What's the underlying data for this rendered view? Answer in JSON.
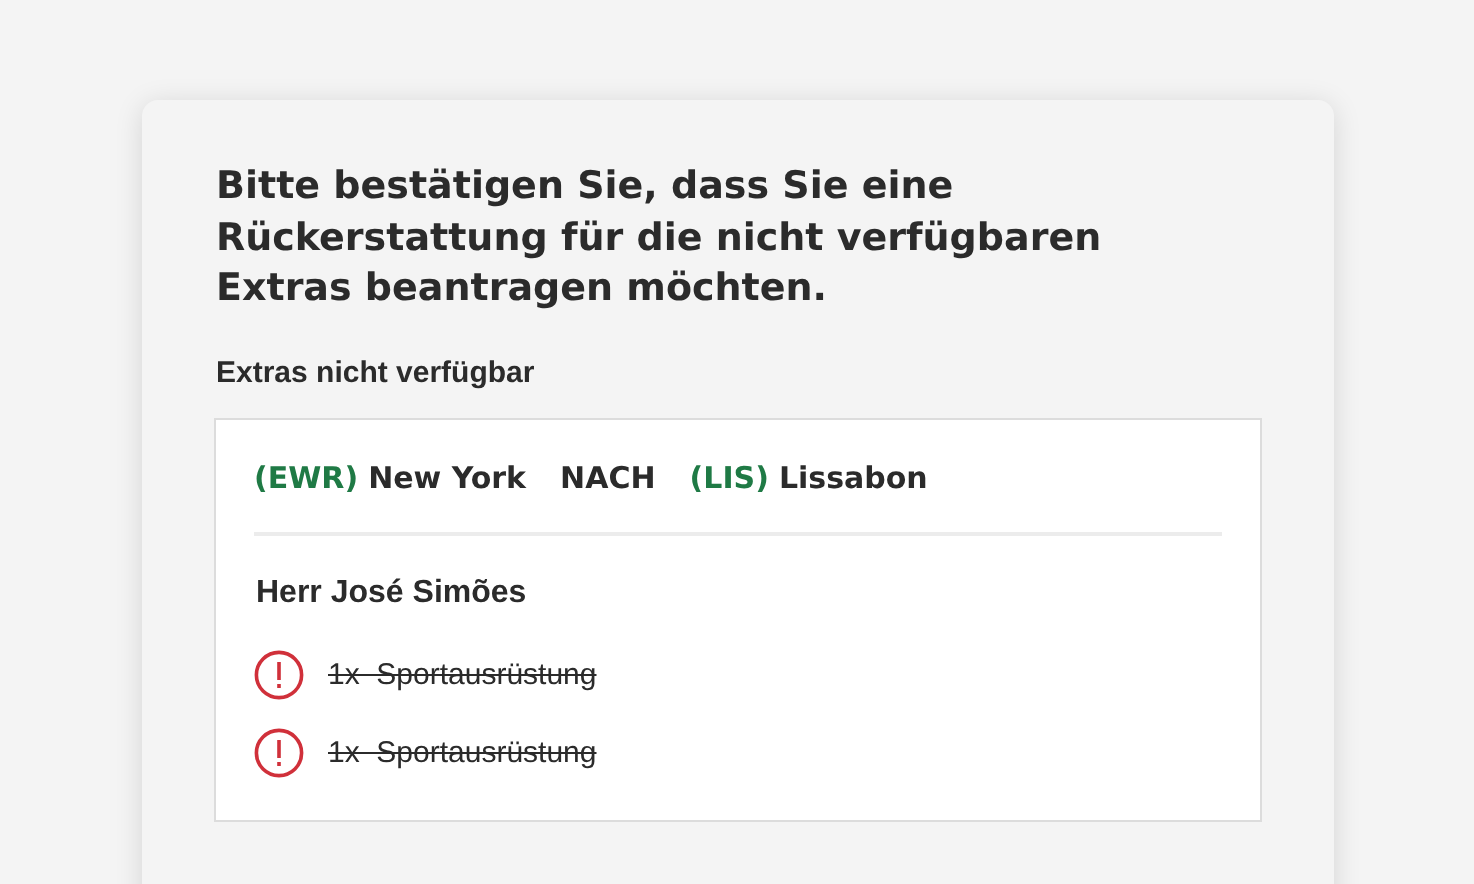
{
  "dialog": {
    "title": "Bitte bestätigen Sie, dass Sie eine Rückerstattung für die nicht verfügbaren Extras beantragen möchten.",
    "section_label": "Extras nicht verfügbar",
    "route": {
      "from_code": "(EWR)",
      "from_city": "New York",
      "connector": "NACH",
      "to_code": "(LIS)",
      "to_city": "Lissabon"
    },
    "passenger": "Herr José Simões",
    "extras": [
      {
        "label": "1x  Sportausrüstung",
        "unavailable": true
      },
      {
        "label": "1x  Sportausrüstung",
        "unavailable": true
      }
    ]
  }
}
